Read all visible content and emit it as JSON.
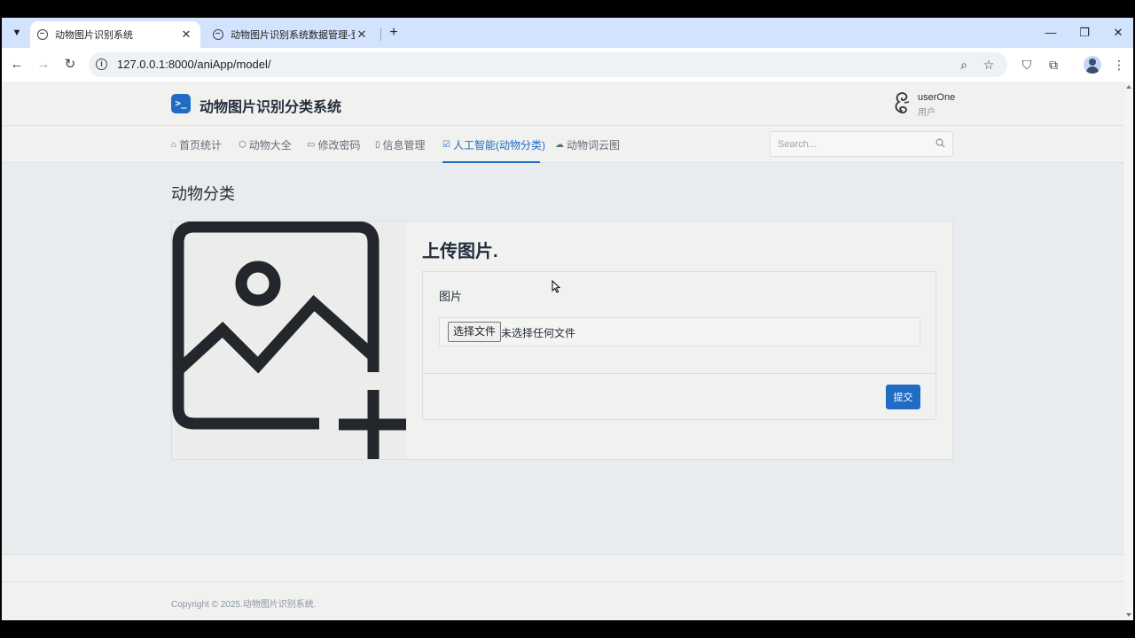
{
  "browser": {
    "tabs": [
      {
        "title": "动物图片识别系统",
        "active": true
      },
      {
        "title": "动物图片识别系统数据管理-登录",
        "active": false
      }
    ],
    "address": "127.0.0.1:8000/aniApp/model/"
  },
  "header": {
    "brand": "动物图片识别分类系统",
    "logo_glyph": ">_",
    "user": {
      "name": "userOne",
      "role": "用户"
    }
  },
  "nav": {
    "items": [
      {
        "label": "首页统计",
        "icon": "home-icon"
      },
      {
        "label": "动物大全",
        "icon": "box-icon"
      },
      {
        "label": "修改密码",
        "icon": "calendar-icon"
      },
      {
        "label": "信息管理",
        "icon": "file-icon"
      },
      {
        "label": "人工智能(动物分类)",
        "icon": "checkbox-icon",
        "active": true
      },
      {
        "label": "动物词云图",
        "icon": "cloud-icon"
      }
    ],
    "search_placeholder": "Search..."
  },
  "main": {
    "page_title": "动物分类",
    "upload_title": "上传图片.",
    "field_label": "图片",
    "file_button": "选择文件",
    "file_status": "未选择任何文件",
    "submit": "提交"
  },
  "footer": {
    "copyright": "Copyright © 2025.动物图片识别系统."
  },
  "colors": {
    "accent": "#206bc4",
    "tabstrip": "#d3e3fd",
    "page_bg": "#e9ecef"
  }
}
